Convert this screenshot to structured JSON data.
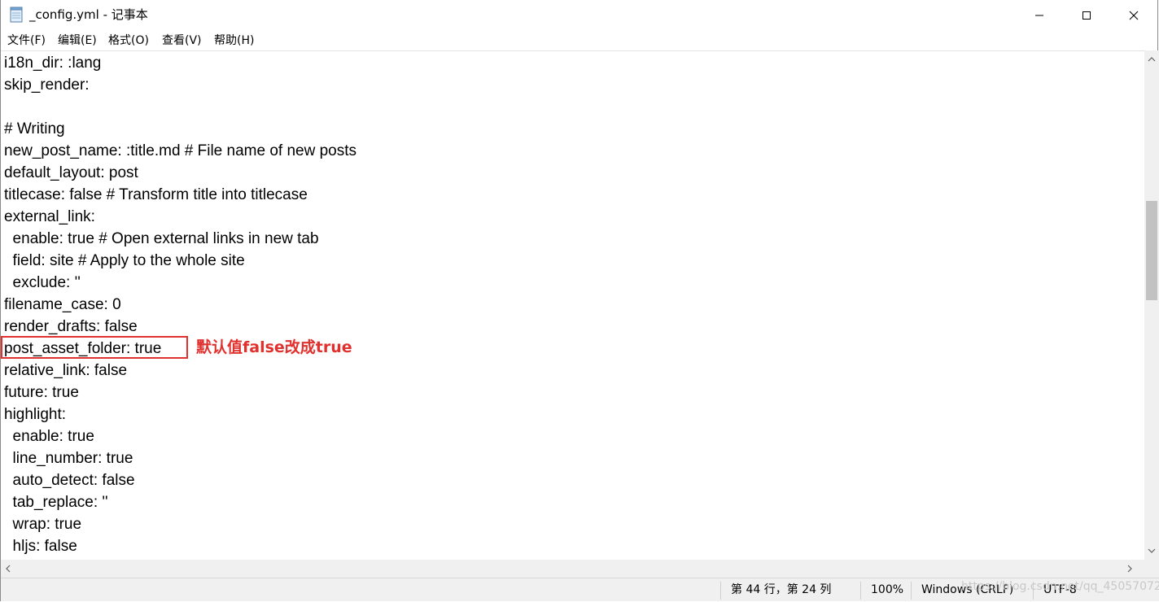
{
  "window": {
    "title": "_config.yml - 记事本"
  },
  "menu": [
    "文件(F)",
    "编辑(E)",
    "格式(O)",
    "查看(V)",
    "帮助(H)"
  ],
  "editor": {
    "lines": [
      "i18n_dir: :lang",
      "skip_render:",
      "",
      "# Writing",
      "new_post_name: :title.md # File name of new posts",
      "default_layout: post",
      "titlecase: false # Transform title into titlecase",
      "external_link:",
      "  enable: true # Open external links in new tab",
      "  field: site # Apply to the whole site",
      "  exclude: ''",
      "filename_case: 0",
      "render_drafts: false",
      "post_asset_folder: true",
      "relative_link: false",
      "future: true",
      "highlight:",
      "  enable: true",
      "  line_number: true",
      "  auto_detect: false",
      "  tab_replace: ''",
      "  wrap: true",
      "  hljs: false"
    ],
    "annotation": "默认值false改成true"
  },
  "status": {
    "position": "第 44 行，第 24 列",
    "zoom": "100%",
    "line_ending": "Windows (CRLF)",
    "encoding": "UTF-8",
    "watermark": "https://blog.csdn.net/qq_45057072"
  },
  "colors": {
    "annotation": "#e0312e",
    "statusbar": "#f0f0f0"
  }
}
